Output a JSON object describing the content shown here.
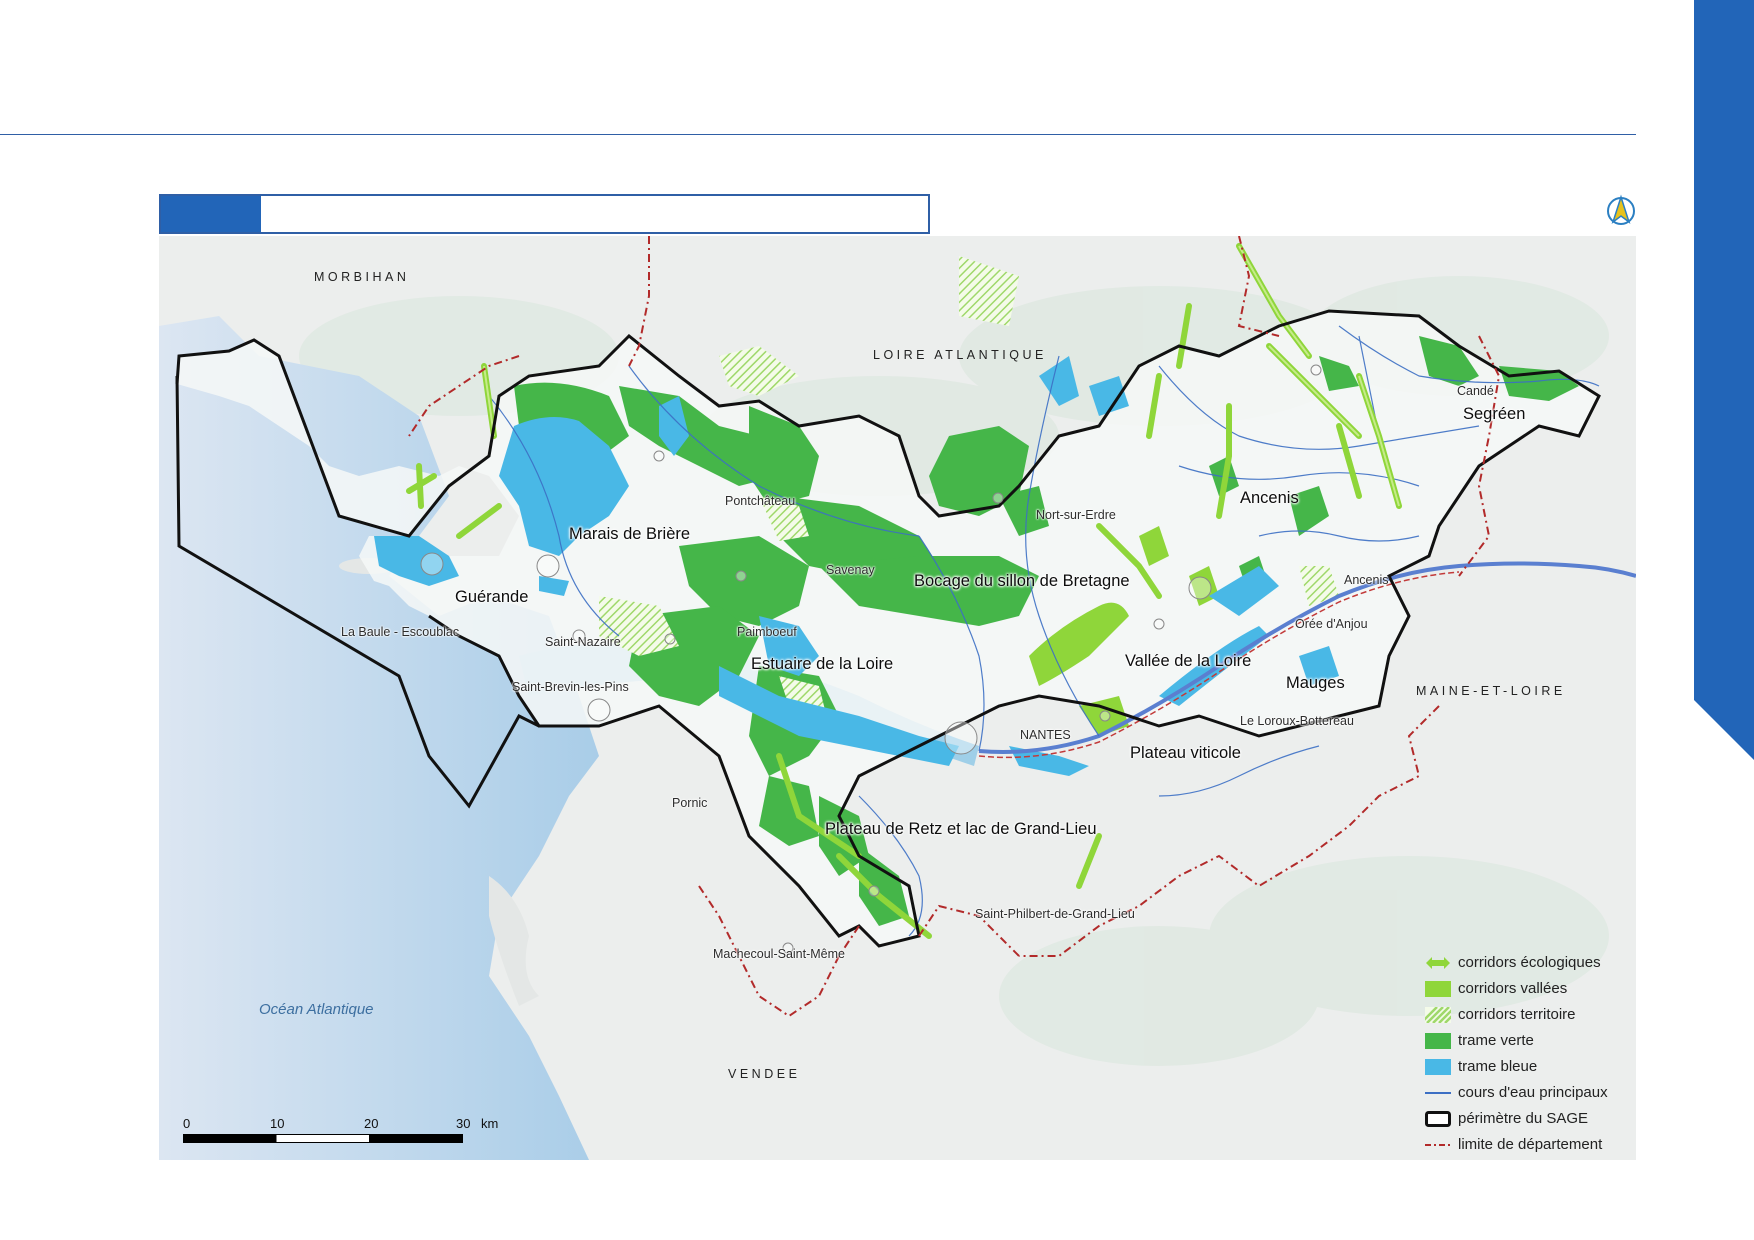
{
  "colors": {
    "brand_blue": "#2265b8",
    "trame_verte": "#45b649",
    "trame_bleue": "#49b8e6",
    "corridor": "#8fd63a",
    "dept_limit": "#b22a2a",
    "rivers": "#3c6fc4"
  },
  "map": {
    "north_arrow_icon": "north-arrow-icon",
    "regions": {
      "morbihan": "MORBIHAN",
      "loire_atlantique": "LOIRE ATLANTIQUE",
      "maine_et_loire": "MAINE-ET-LOIRE",
      "vendee": "VENDEE"
    },
    "ocean": "Océan Atlantique",
    "zones": {
      "marais": "Marais de Brière",
      "guerande": "Guérande",
      "estuaire": "Estuaire de la Loire",
      "bocage": "Bocage du sillon de Bretagne",
      "vallee": "Vallée de la Loire",
      "ancenis": "Ancenis",
      "segreen": "Segréen",
      "mauges": "Mauges",
      "plateau_viticole": "Plateau viticole",
      "plateau_retz": "Plateau de Retz et lac de Grand-Lieu"
    },
    "towns": {
      "pontchateau": "Pontchâteau",
      "savenay": "Savenay",
      "nort": "Nort-sur-Erdre",
      "la_baule": "La Baule - Escoublac",
      "saint_nazaire": "Saint-Nazaire",
      "paimboeuf": "Paimboeuf",
      "saint_brevin": "Saint-Brevin-les-Pins",
      "nantes": "NANTES",
      "pornic": "Pornic",
      "saint_philbert": "Saint-Philbert-de-Grand-Lieu",
      "machecoul": "Machecoul-Saint-Même",
      "ancenis_town": "Ancenis",
      "oree": "Orée d'Anjou",
      "loroux": "Le Loroux-Bottereau",
      "cande": "Candé"
    },
    "scale": {
      "ticks": [
        "0",
        "10",
        "20",
        "30"
      ],
      "unit": "km"
    }
  },
  "legend": [
    {
      "id": "corridors-ecologiques",
      "label": "corridors écologiques",
      "icon": "double-arrow"
    },
    {
      "id": "corridors-vallees",
      "label": "corridors vallées",
      "color": "#8fd63a"
    },
    {
      "id": "corridors-territoire",
      "label": "corridors territoire",
      "icon": "hatch"
    },
    {
      "id": "trame-verte",
      "label": "trame verte",
      "color": "#45b649"
    },
    {
      "id": "trame-bleue",
      "label": "trame bleue",
      "color": "#49b8e6"
    },
    {
      "id": "cours-eau",
      "label": "cours d'eau principaux",
      "icon": "line"
    },
    {
      "id": "perimetre",
      "label": "périmètre du SAGE",
      "icon": "outline"
    },
    {
      "id": "limite-dept",
      "label": "limite de département",
      "icon": "dash"
    }
  ]
}
